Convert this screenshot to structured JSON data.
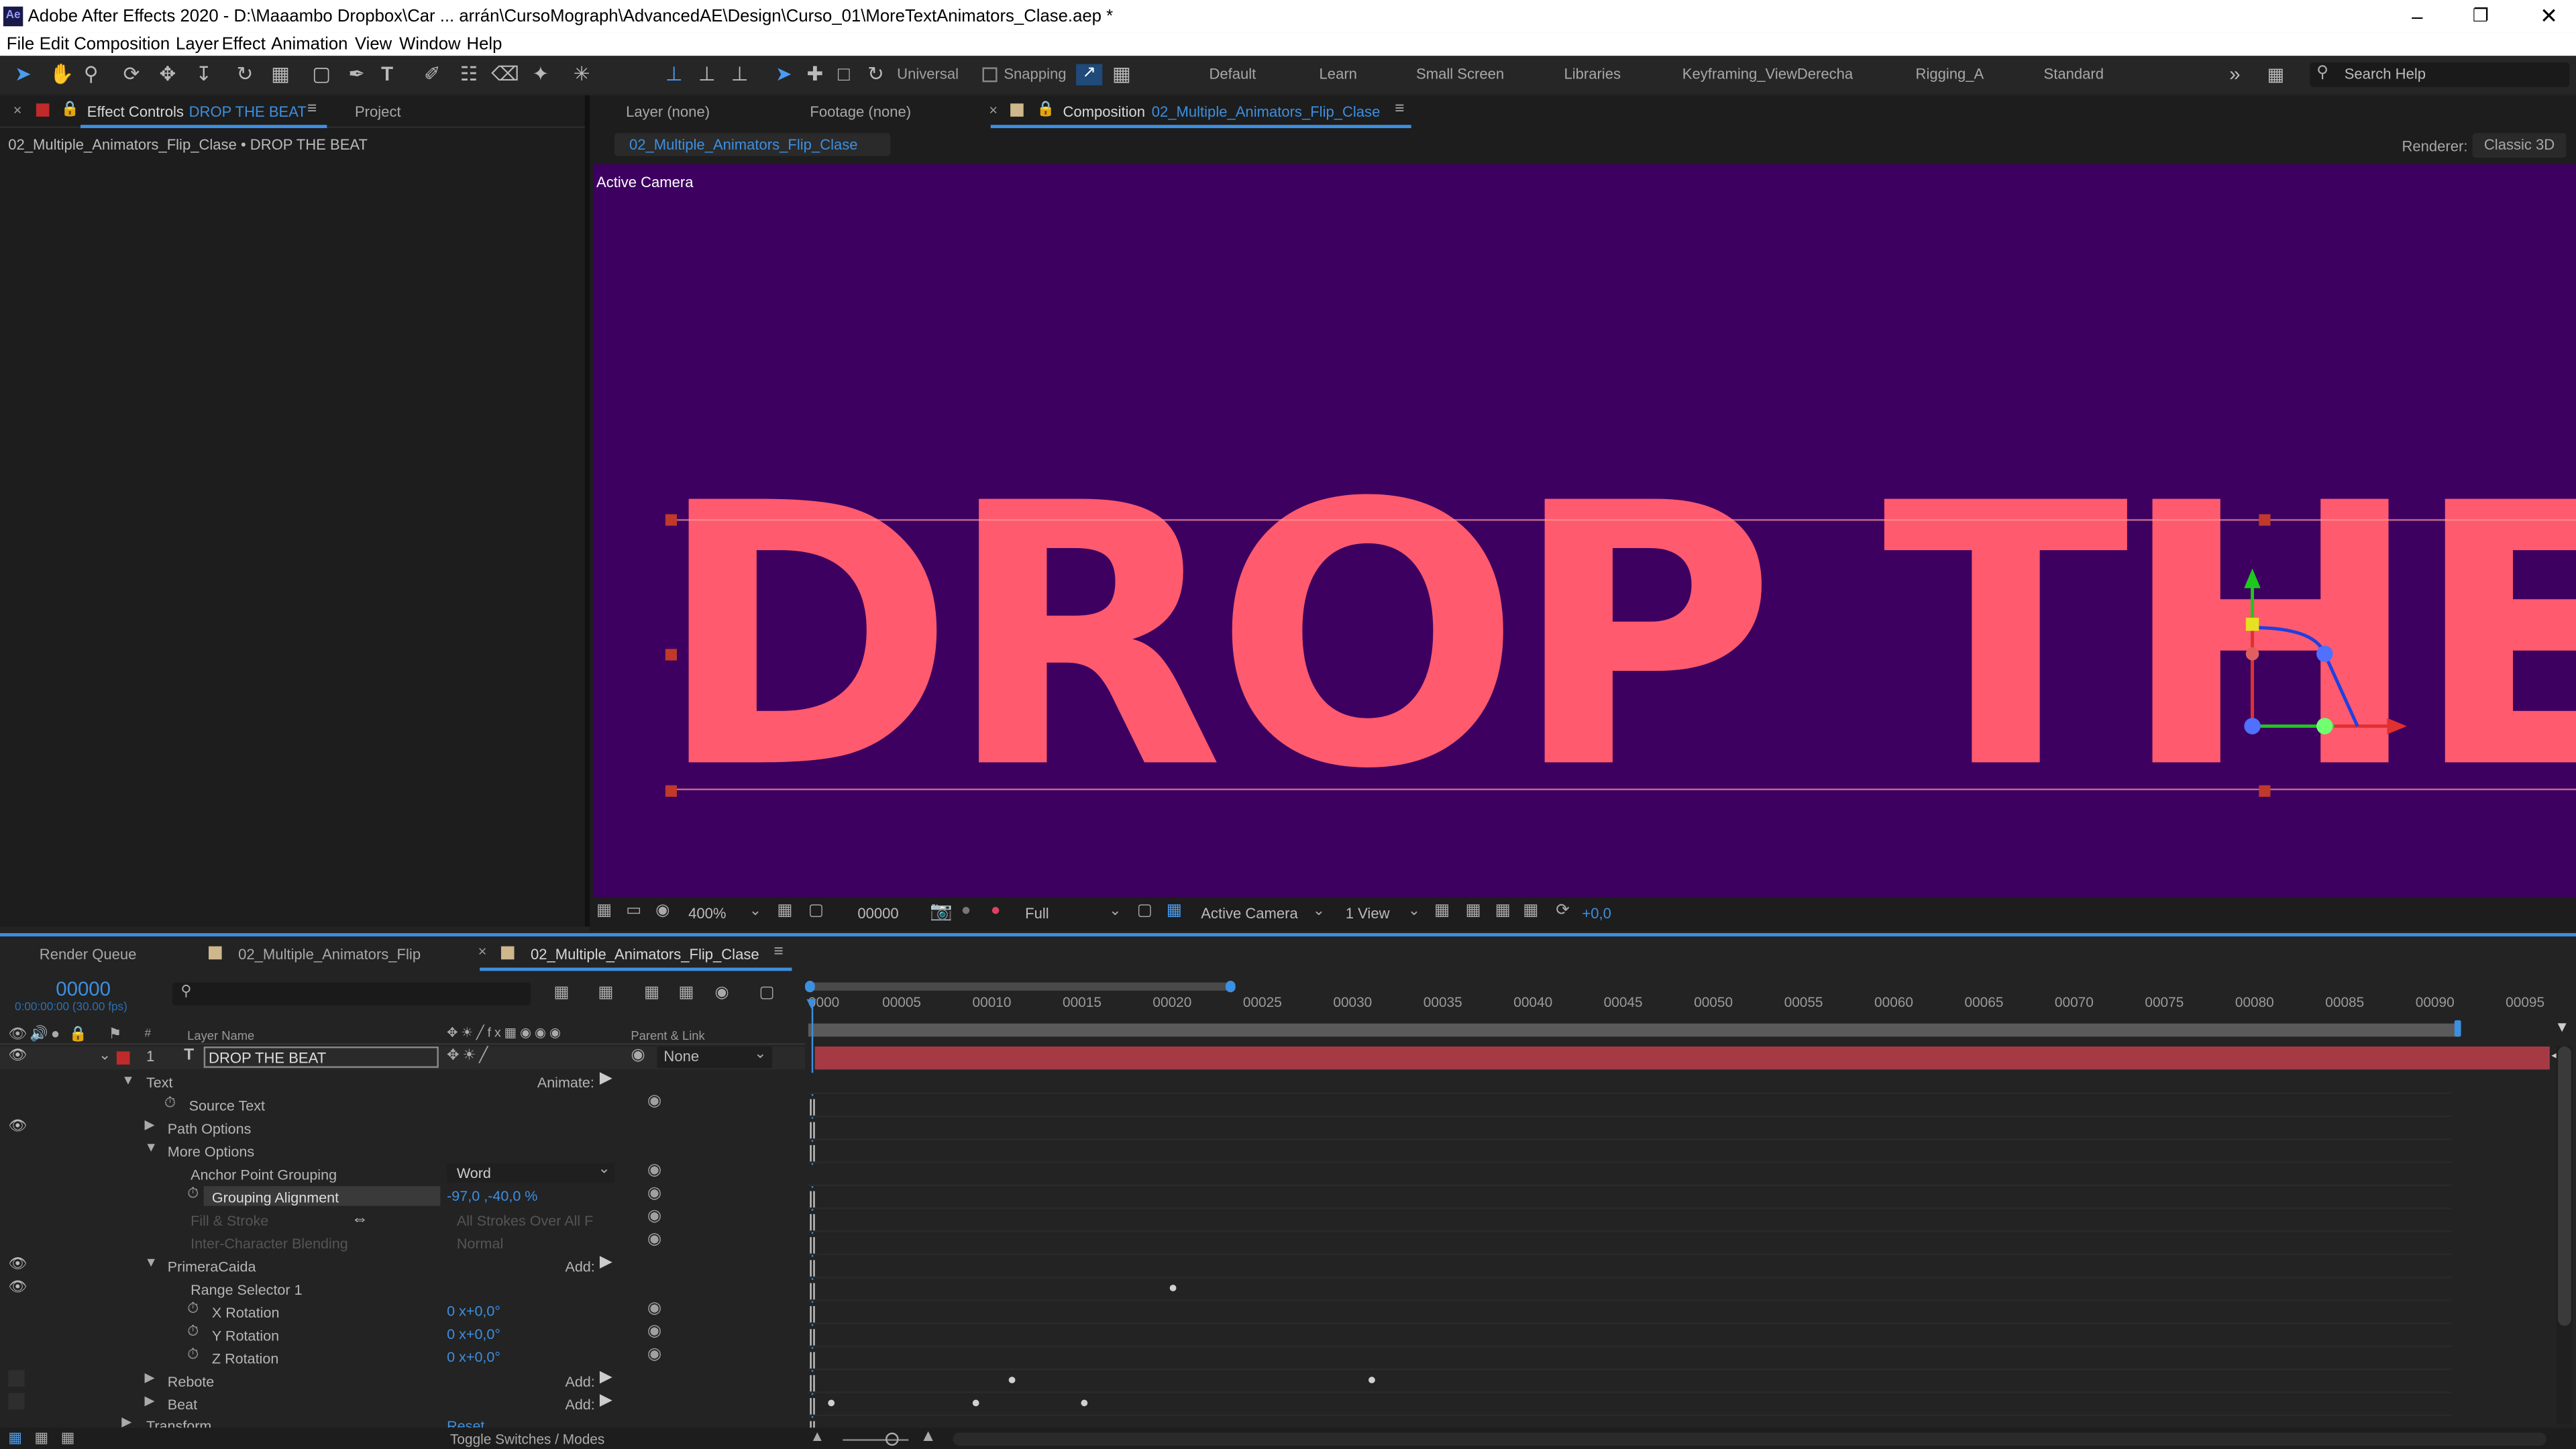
{
  "window": {
    "title": "Adobe After Effects 2020 - D:\\Maaambo Dropbox\\Car ... arrán\\CursoMograph\\AdvancedAE\\Design\\Curso_01\\MoreTextAnimators_Clase.aep *",
    "app_icon": "Ae"
  },
  "menu": [
    "File",
    "Edit",
    "Composition",
    "Layer",
    "Effect",
    "Animation",
    "View",
    "Window",
    "Help"
  ],
  "toolbar": {
    "universal": "Universal",
    "snapping": "Snapping",
    "workspaces": [
      "Default",
      "Learn",
      "Small Screen",
      "Libraries",
      "Keyframing_ViewDerecha",
      "Rigging_A",
      "Standard"
    ],
    "search_placeholder": "Search Help"
  },
  "effect_controls": {
    "tab": "Effect Controls",
    "tab_layer": "DROP THE BEAT",
    "project_tab": "Project",
    "breadcrumb": "02_Multiple_Animators_Flip_Clase • DROP THE BEAT"
  },
  "viewer": {
    "layer_tab": "Layer (none)",
    "footage_tab": "Footage (none)",
    "comp_tab_prefix": "Composition",
    "comp_name": "02_Multiple_Animators_Flip_Clase",
    "comp_subtab": "02_Multiple_Animators_Flip_Clase",
    "renderer_label": "Renderer:",
    "renderer": "Classic 3D",
    "active_camera": "Active Camera",
    "canvas_text": "DROP THE BEAT",
    "bg_color": "#3d0060",
    "text_color": "#ff5a6e"
  },
  "viewer_footer": {
    "zoom": "400%",
    "timecode": "00000",
    "resolution": "Full",
    "view": "Active Camera",
    "views": "1 View",
    "exposure": "+0,0"
  },
  "timeline": {
    "tabs": [
      "Render Queue",
      "02_Multiple_Animators_Flip",
      "02_Multiple_Animators_Flip_Clase"
    ],
    "timecode": "00000",
    "timecode_sub": "0:00:00:00 (30.00 fps)",
    "col_layer_name": "Layer Name",
    "col_parent": "Parent & Link",
    "toggle": "Toggle Switches / Modes",
    "ruler": [
      "0000",
      "00005",
      "00010",
      "00015",
      "00020",
      "00025",
      "00030",
      "00035",
      "00040",
      "00045",
      "00050",
      "00055",
      "00060",
      "00065",
      "00070",
      "00075",
      "00080",
      "00085",
      "00090",
      "00095"
    ],
    "layer": {
      "index": "1",
      "type": "T",
      "name": "DROP THE BEAT",
      "parent": "None"
    },
    "props": {
      "text": "Text",
      "animate": "Animate:",
      "source_text": "Source Text",
      "path_options": "Path Options",
      "more_options": "More Options",
      "anchor_grouping": "Anchor Point Grouping",
      "anchor_grouping_val": "Word",
      "grouping_alignment": "Grouping Alignment",
      "grouping_alignment_val": "-97,0 ,-40,0 %",
      "fill_stroke": "Fill & Stroke",
      "fill_stroke_val": "All Strokes Over All F",
      "inter_char": "Inter-Character Blending",
      "inter_char_val": "Normal",
      "primera": "PrimeraCaida",
      "add": "Add:",
      "range_sel": "Range Selector 1",
      "xrot": "X Rotation",
      "yrot": "Y Rotation",
      "zrot": "Z Rotation",
      "rot_val": "0 x+0,0°",
      "rebote": "Rebote",
      "beat": "Beat",
      "transform": "Transform",
      "reset": "Reset"
    }
  }
}
